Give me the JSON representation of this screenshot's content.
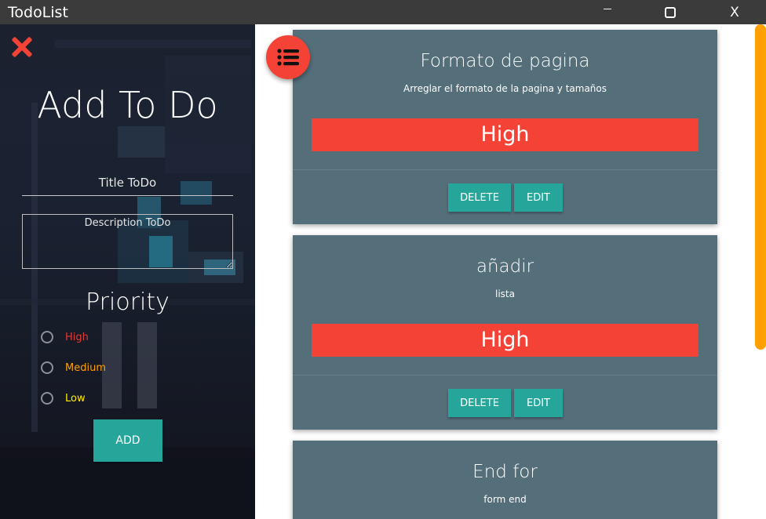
{
  "window": {
    "title": "TodoList",
    "minimize_label": "",
    "close_label": "X"
  },
  "sidebar": {
    "heading": "Add To Do",
    "title_placeholder": "Title ToDo",
    "description_placeholder": "Description ToDo",
    "priority_heading": "Priority",
    "priorities": [
      {
        "label": "High",
        "color": "#e53935"
      },
      {
        "label": "Medium",
        "color": "#ffa000"
      },
      {
        "label": "Low",
        "color": "#ffea00"
      }
    ],
    "add_label": "ADD"
  },
  "colors": {
    "accent_red": "#f44336",
    "accent_teal": "#26a69a",
    "card_bg": "#546e7a",
    "scrollbar": "#ffa000"
  },
  "todos": [
    {
      "title": "Formato de pagina",
      "description": "Arreglar el formato de la pagina y tamaños",
      "priority": "High",
      "delete_label": "DELETE",
      "edit_label": "EDIT"
    },
    {
      "title": "añadir",
      "description": "lista",
      "priority": "High",
      "delete_label": "DELETE",
      "edit_label": "EDIT"
    },
    {
      "title": "End for",
      "description": "form end"
    }
  ],
  "icons": {
    "close": "close-x-icon",
    "menu": "list-menu-icon"
  }
}
